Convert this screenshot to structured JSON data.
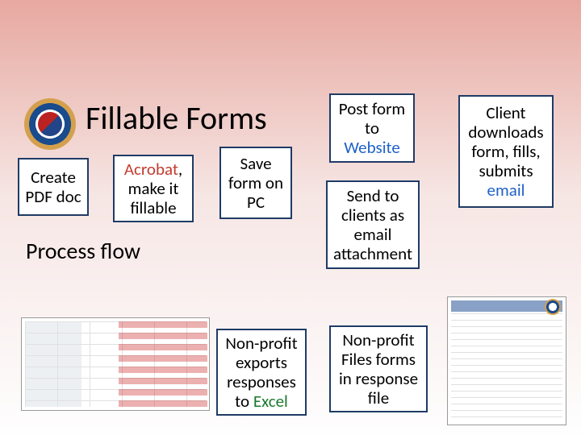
{
  "title": "Fillable Forms",
  "process_label": "Process flow",
  "boxes": {
    "create": "Create PDF doc",
    "acrobat": {
      "pre": "Acrobat",
      "post": ", make it fillable"
    },
    "save": "Save form on PC",
    "post": {
      "pre": "Post form to ",
      "link": "Website"
    },
    "send": "Send to clients as email attachment",
    "client": {
      "pre": "Client downloads form, fills, submits ",
      "link": "email"
    },
    "export": {
      "pre": "Non-profit exports responses to ",
      "link": "Excel"
    },
    "files": "Non-profit Files forms in response file"
  },
  "thumbs": {
    "excel": "excel-table-thumbnail",
    "pdf": "pdf-form-thumbnail"
  },
  "colors": {
    "box_border": "#1f3b66",
    "link_blue": "#1f61c8",
    "accent_red": "#c23b2e",
    "accent_green": "#1a7a2e"
  }
}
